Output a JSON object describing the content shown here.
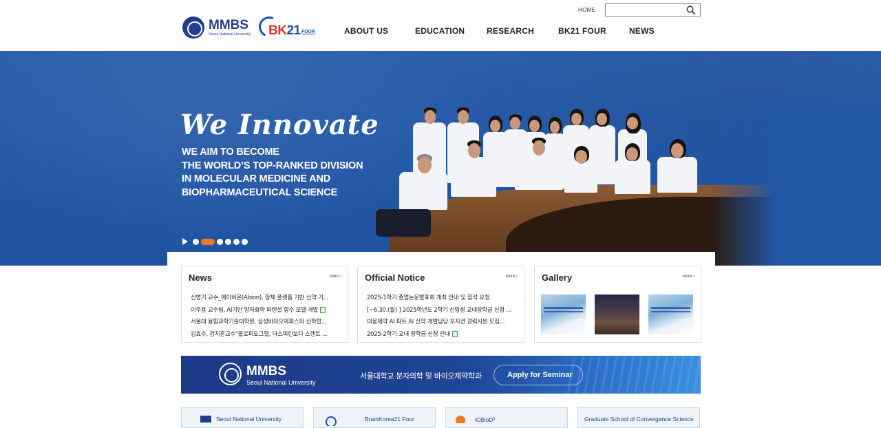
{
  "header": {
    "logo_mmbs": "MMBS",
    "logo_mmbs_sub": "Seoul National University",
    "logo_bk_prefix": "BK",
    "logo_bk_num": "21",
    "logo_bk_four": "FOUR",
    "home": "HOME",
    "search_placeholder": ""
  },
  "nav": {
    "items": [
      {
        "label": "ABOUT US"
      },
      {
        "label": "EDUCATION"
      },
      {
        "label": "RESEARCH"
      },
      {
        "label": "BK21 FOUR"
      },
      {
        "label": "NEWS"
      }
    ]
  },
  "hero": {
    "title": "We Innovate",
    "lines": [
      "WE AIM TO BECOME",
      "THE WORLD’S TOP-RANKED DIVISION",
      "IN MOLECULAR MEDICINE AND",
      "BIOPHARMACEUTICAL SCIENCE"
    ],
    "slide_count": 7,
    "active_slide": 2
  },
  "news": {
    "title": "News",
    "more": "more ›",
    "items": [
      {
        "text": "신영기 교수_에이비온(Abion), 항체 플랫폼 기반 신약 기..."
      },
      {
        "text": "이주용 교수팀, AI기반 양자화학 퍼텐셜 함수 모델 개발",
        "file": true
      },
      {
        "text": "서울대 융합과학기술대학원, 삼성바이오에피스와 산학협..."
      },
      {
        "text": "김효수, 강지훈교수\"콜로피도그렐, 아스피린보다 스텐트 ..."
      }
    ]
  },
  "notice": {
    "title": "Official Notice",
    "more": "more ›",
    "items": [
      {
        "text": "2025-1학기 졸업논문발표회 개최 안내 및 참석 요청"
      },
      {
        "text": "[~6.30.(월) ] 2025학년도 2학기 신입생 교내장학금 신청 ..."
      },
      {
        "text": "대웅제약 AI 파트 AI 신약 개발담당 포지션 경력사원 모집..."
      },
      {
        "text": "2025-2학기 교내 장학금 신청 안내",
        "file": true
      }
    ]
  },
  "gallery": {
    "title": "Gallery",
    "more": "more ›",
    "thumbs": [
      "poster",
      "group-photo",
      "poster"
    ]
  },
  "banner": {
    "mmbs": "MMBS",
    "mmbs_sub": "Seoul National University",
    "korean": "서울대학교 분자의학 및 바이오제약학과",
    "button": "Apply for Seminar"
  },
  "partners": [
    {
      "label": "Seoul National University"
    },
    {
      "label": "BrainKorea21 Four"
    },
    {
      "label": "iCBioD³"
    },
    {
      "label": "Graduate School of Convergence Science"
    }
  ],
  "colors": {
    "brand_blue": "#1e3f8e",
    "hero_blue": "#2257a6",
    "accent_orange": "#f07a22",
    "bk_red": "#e8332a"
  }
}
